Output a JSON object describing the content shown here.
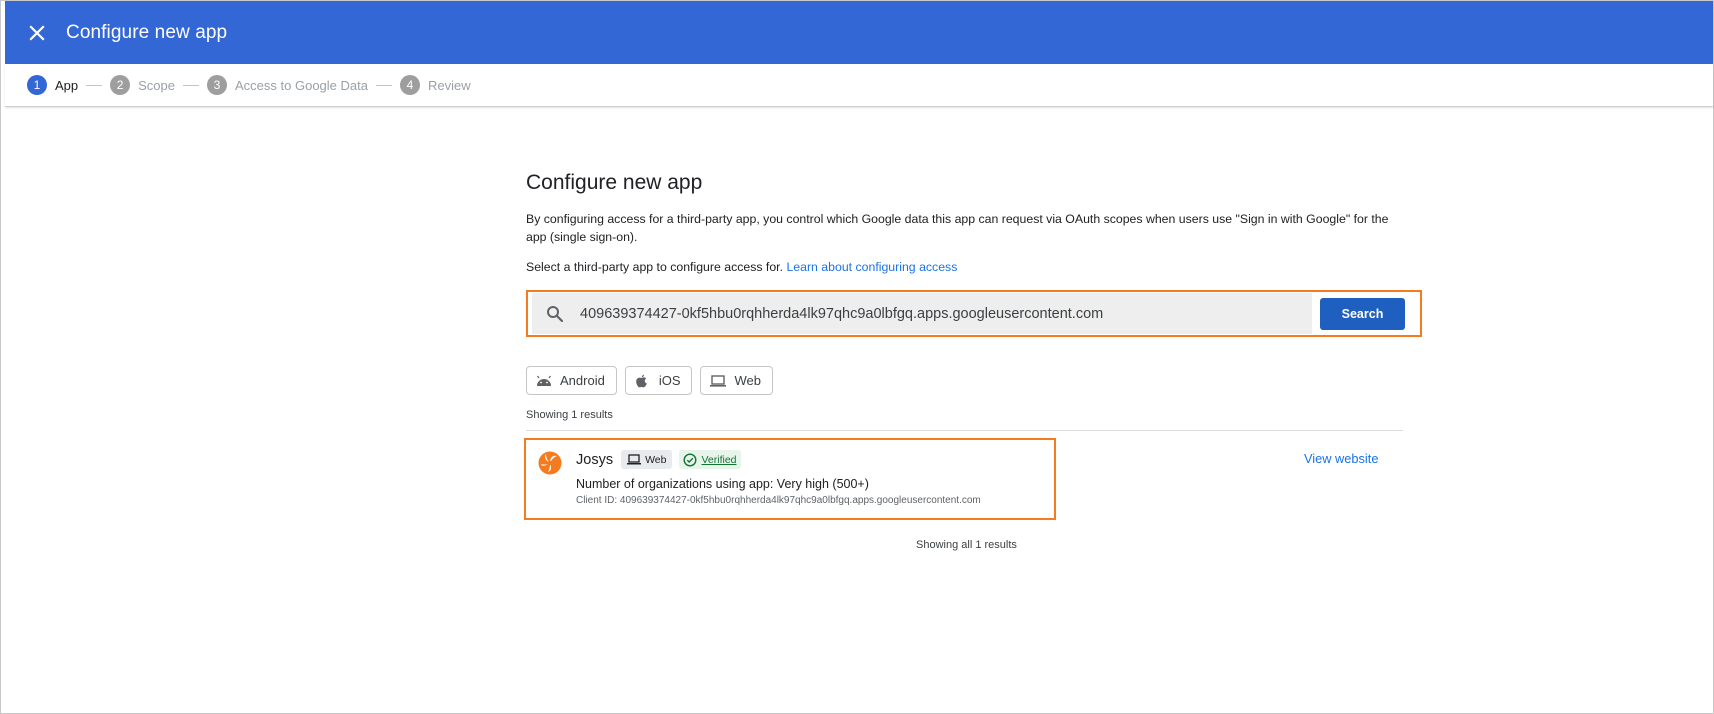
{
  "header": {
    "title": "Configure new app"
  },
  "stepper": {
    "steps": [
      {
        "number": "1",
        "label": "App",
        "active": true
      },
      {
        "number": "2",
        "label": "Scope",
        "active": false
      },
      {
        "number": "3",
        "label": "Access to Google Data",
        "active": false
      },
      {
        "number": "4",
        "label": "Review",
        "active": false
      }
    ]
  },
  "main": {
    "title": "Configure new app",
    "description": "By configuring access for a third-party app, you control which Google data this app can request via OAuth scopes when users use \"Sign in with Google\" for the app (single sign-on).",
    "select_text": "Select a third-party app to configure access for.",
    "learn_link": "Learn about configuring access"
  },
  "search": {
    "value": "409639374427-0kf5hbu0rqhherda4lk97qhc9a0lbfgq.apps.googleusercontent.com",
    "button_label": "Search"
  },
  "filters": [
    {
      "label": "Android",
      "icon": "android-icon"
    },
    {
      "label": "iOS",
      "icon": "apple-icon"
    },
    {
      "label": "Web",
      "icon": "laptop-icon"
    }
  ],
  "results": {
    "showing_text": "Showing 1 results",
    "items": [
      {
        "name": "Josys",
        "platform_tag": "Web",
        "verified_label": "Verified",
        "orgs_text": "Number of organizations using app: Very high (500+)",
        "client_id_text": "Client ID: 409639374427-0kf5hbu0rqhherda4lk97qhc9a0lbfgq.apps.googleusercontent.com",
        "view_link": "View website"
      }
    ],
    "showing_all_text": "Showing all 1 results"
  },
  "colors": {
    "header": "#3367d6",
    "primary_button": "#1f5fbf",
    "highlight_border": "#f47b20",
    "link": "#1a73e8",
    "verified": "#137333",
    "logo": "#f47b20"
  }
}
